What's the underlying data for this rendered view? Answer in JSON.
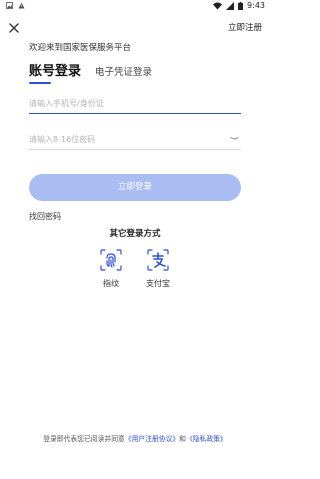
{
  "status_bar": {
    "time": "9:43",
    "left_icons": [
      "gallery-icon",
      "warning-icon"
    ],
    "right_icons": [
      "wifi-icon",
      "signal-icon",
      "battery-icon"
    ]
  },
  "header": {
    "close_icon": "close-icon",
    "register_label": "立即注册"
  },
  "welcome_text": "欢迎来到国家医保服务平台",
  "tabs": [
    {
      "label": "账号登录",
      "active": true
    },
    {
      "label": "电子凭证登录",
      "active": false
    }
  ],
  "form": {
    "account_placeholder": "请输入手机号/身份证",
    "account_value": "",
    "password_placeholder": "请输入8-16位密码",
    "password_value": "",
    "submit_label": "立即登录"
  },
  "forgot_password": "找回密码",
  "other_methods": {
    "title": "其它登录方式",
    "items": [
      {
        "label": "指纹",
        "icon": "fingerprint-icon"
      },
      {
        "label": "支付宝",
        "icon": "alipay-icon"
      }
    ]
  },
  "agreement": {
    "prefix": "登录即代表您已阅读并同意",
    "user_agreement": "《用户注册协议》",
    "conjunction": "和",
    "privacy_policy": "《隐私政策》"
  },
  "colors": {
    "accent": "#2f4fd6",
    "button_disabled": "#a9bdf3",
    "divider": "#d8d8d8"
  }
}
